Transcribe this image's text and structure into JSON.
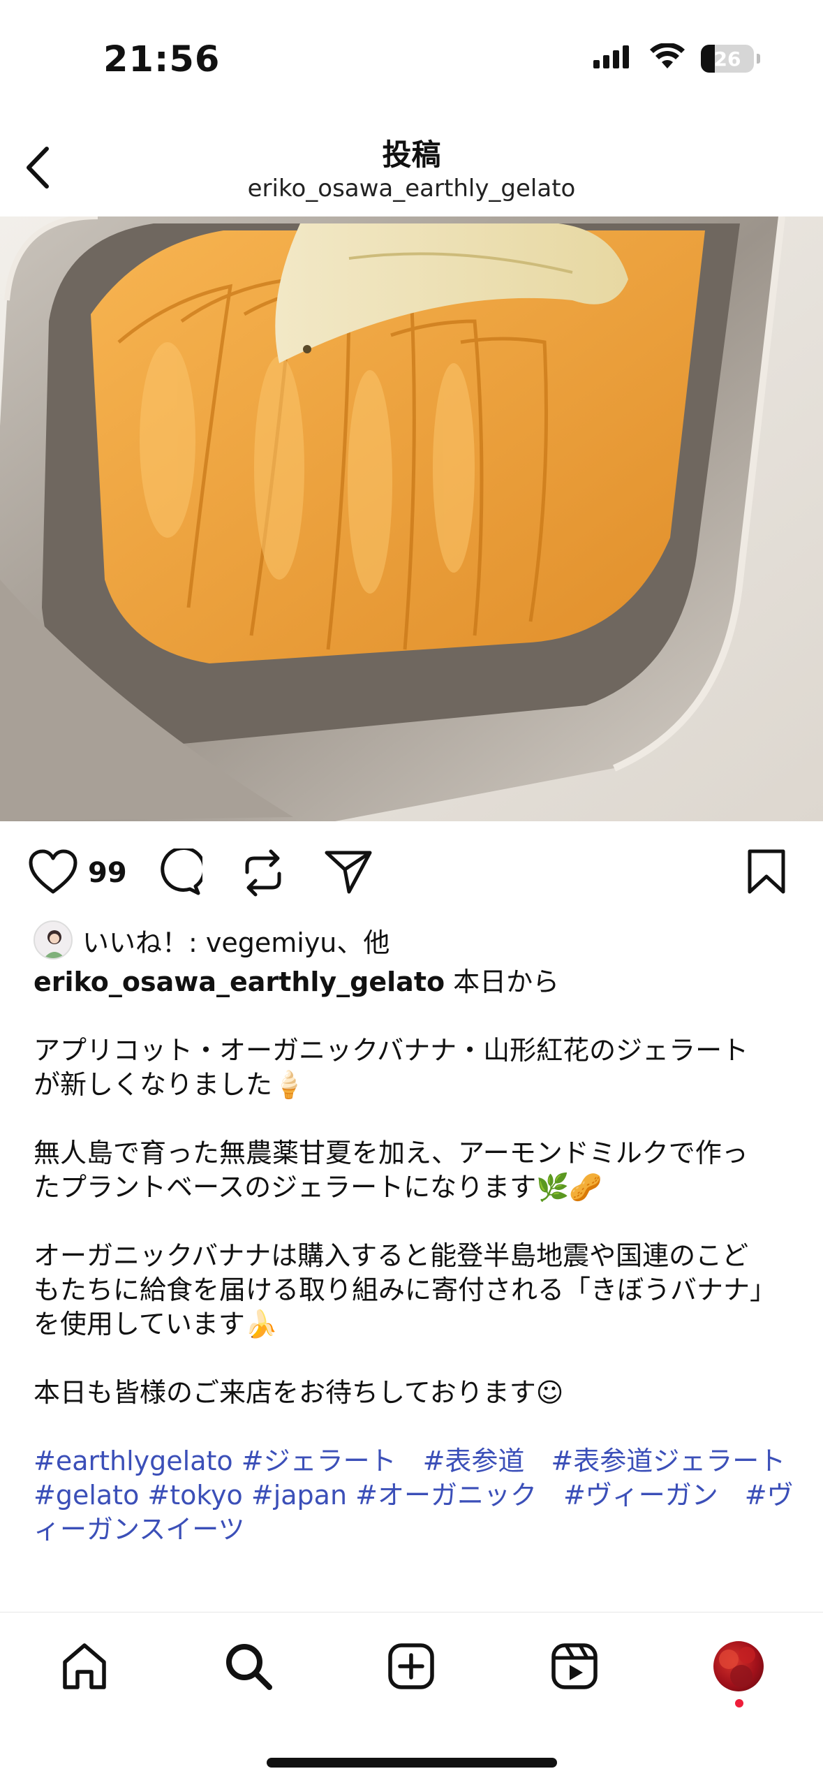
{
  "status_bar": {
    "time": "21:56",
    "battery_level": "26",
    "icons": [
      "signal-icon",
      "wifi-icon",
      "battery-icon"
    ]
  },
  "header": {
    "title": "投稿",
    "subtitle": "eriko_osawa_earthly_gelato"
  },
  "actions": {
    "like_count": "99",
    "icons": [
      "heart-icon",
      "comment-icon",
      "repost-icon",
      "share-icon",
      "bookmark-icon"
    ]
  },
  "likes_line": {
    "text": "いいね！: vegemiyu、他"
  },
  "caption": {
    "username": "eriko_osawa_earthly_gelato",
    "first_line": " 本日から",
    "para1_line1": "アプリコット・オーガニックバナナ・山形紅花のジェラート",
    "para1_line2": "が新しくなりました🍦",
    "para2_line1": "無人島で育った無農薬甘夏を加え、アーモンドミルクで作っ",
    "para2_line2": "たプラントベースのジェラートになります🌿🥜",
    "para3_line1": "オーガニックバナナは購入すると能登半島地震や国連のこど",
    "para3_line2": "もたちに給食を届ける取り組みに寄付される「きぼうバナナ」",
    "para3_line3": "を使用しています🍌",
    "para4_line1": "本日も皆様のご来店をお待ちしております☺",
    "hashtags_line1": "#earthlygelato #ジェラート　#表参道　#表参道ジェラート",
    "hashtags_line2": "#gelato #tokyo #japan #オーガニック　#ヴィーガン　#ヴ",
    "hashtags_line3": "ィーガンスイーツ"
  },
  "bottom_nav": {
    "items": [
      "home-icon",
      "search-icon",
      "create-icon",
      "reels-icon",
      "profile-avatar"
    ]
  },
  "colors": {
    "hashtag": "#3b4fb8",
    "notification_dot": "#ee1d3a",
    "gelato": "#f0a43c"
  }
}
